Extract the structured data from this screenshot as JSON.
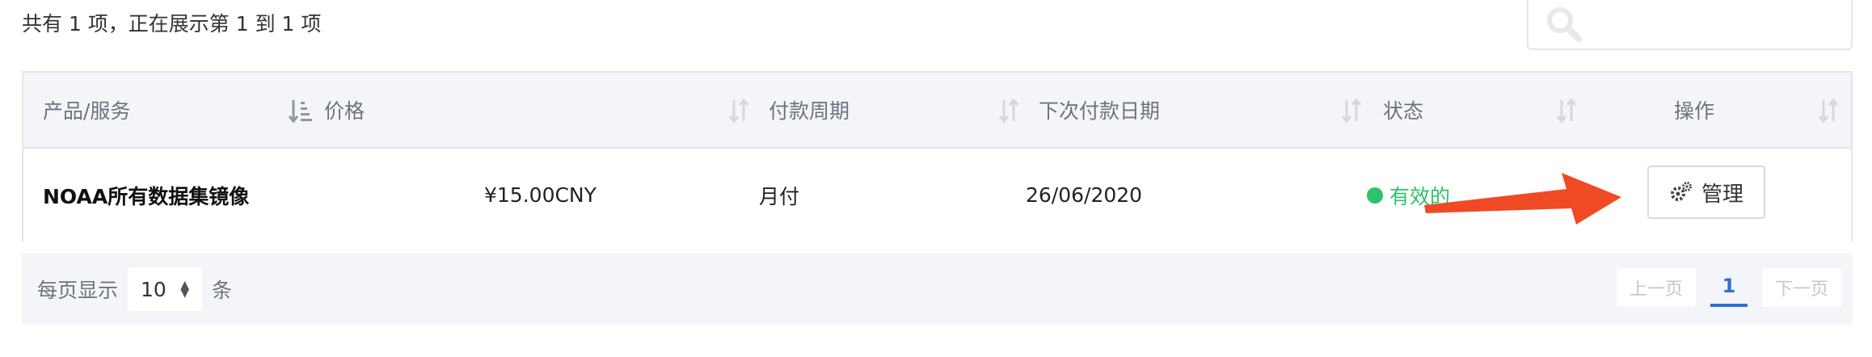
{
  "summary": "共有 1 项，正在展示第 1 到 1 项",
  "search": {
    "placeholder": ""
  },
  "table": {
    "headers": [
      "产品/服务",
      "价格",
      "付款周期",
      "下次付款日期",
      "状态",
      "操作"
    ],
    "rows": [
      {
        "product": "NOAA所有数据集镜像",
        "price": "¥15.00CNY",
        "cycle": "月付",
        "next_date": "26/06/2020",
        "status": "有效的",
        "action": "管理"
      }
    ]
  },
  "footer": {
    "per_page_prefix": "每页显示",
    "per_page_value": "10",
    "per_page_suffix": "条",
    "prev": "上一页",
    "current_page": "1",
    "next": "下一页"
  },
  "colors": {
    "status_active": "#2ec26a",
    "arrow": "#f04a25",
    "pager_active": "#2f6fd0"
  },
  "icons": [
    "search-icon",
    "sort-icon",
    "gear-icon",
    "arrow-annotation"
  ]
}
